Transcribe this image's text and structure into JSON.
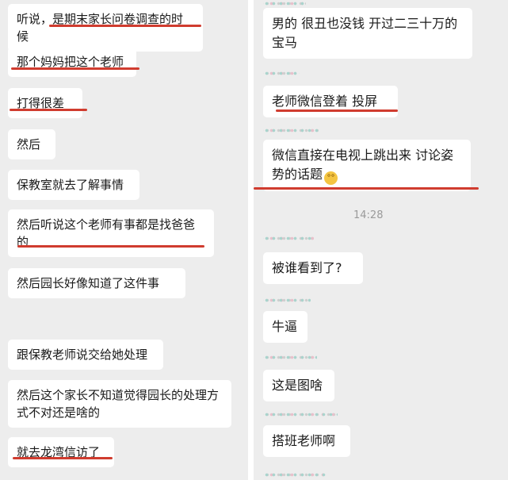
{
  "left_messages": [
    {
      "text": "听说，是期末家长问卷调查的时候"
    },
    {
      "text": "那个妈妈把这个老师"
    },
    {
      "text": "打得很差"
    },
    {
      "text": "然后"
    },
    {
      "text": "保教室就去了解事情"
    },
    {
      "text": "然后听说这个老师有事都是找爸爸的"
    },
    {
      "text": "然后园长好像知道了这件事"
    },
    {
      "text": "跟保教老师说交给她处理"
    },
    {
      "text": "然后这个家长不知道觉得园长的处理方式不对还是啥的"
    },
    {
      "text": "就去龙湾信访了"
    }
  ],
  "right_messages": [
    {
      "text": "男的 很丑也没钱 开过二三十万的宝马"
    },
    {
      "text": "老师微信登着 投屏"
    },
    {
      "text": "微信直接在电视上跳出来 讨论姿势的话题",
      "emoji": "flushed-face-emoji"
    },
    {
      "text": "被谁看到了?"
    },
    {
      "text": "牛逼"
    },
    {
      "text": "这是图啥"
    },
    {
      "text": "搭班老师啊"
    }
  ],
  "timestamp": "14:28",
  "colors": {
    "background": "#ededed",
    "bubble": "#ffffff",
    "text": "#1a1a1a",
    "underline": "#d03c2f",
    "timestamp": "#9a9a9a"
  }
}
